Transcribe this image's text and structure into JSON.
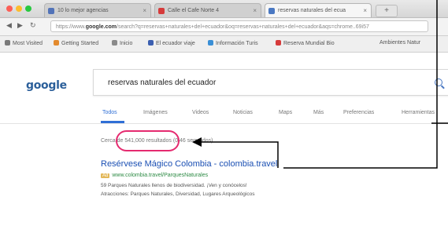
{
  "browser": {
    "tabs": [
      {
        "label": "10 lo mejor agencias",
        "active": false
      },
      {
        "label": "Calle el Cafe Norte 4",
        "active": false
      },
      {
        "label": "reservas naturales del ecua",
        "active": true
      }
    ],
    "tab_close": "×",
    "new_tab": "+",
    "back": "◀",
    "forward": "▶",
    "reload": "↻",
    "url_prefix": "https://www.",
    "url_domain": "google.com",
    "url_rest": "/search?q=reservas+naturales+del+ecuador&oq=reservas+naturales+del+ecuador&aqs=chrome..69i57",
    "bookmarks": [
      "Most Visited",
      "Getting Started",
      "Inicio",
      "El ecuador viaje",
      "Información Turis",
      "Reserva Mundial Bio",
      "Ambientes Natur"
    ]
  },
  "search": {
    "logo": "google",
    "query": "reservas naturales del ecuador",
    "tabs": [
      "Todos",
      "Imágenes",
      "Videos",
      "Noticias",
      "Maps",
      "Más",
      "Preferencias",
      "Herramientas"
    ],
    "stats_prefix": "Cerca de",
    "stats_count": "541,000",
    "stats_suffix": "resultados (0.46 segundos)"
  },
  "result": {
    "title": "Resérvese Mágico Colombia - colombia.travel",
    "ad_badge": "Ad",
    "url": "www.colombia.travel/ParquesNaturales",
    "snippet1": "59 Parques Naturales llenos de biodiversidad. ¡Ven y conócelos!",
    "snippet2": "Atracciones: Parques Naturales, Diversidad, Lugares Arqueológicos"
  },
  "colors": {
    "highlight": "#e52a6f",
    "arrow": "#000000",
    "link": "#1a4fb3",
    "url_green": "#2e8b45"
  }
}
